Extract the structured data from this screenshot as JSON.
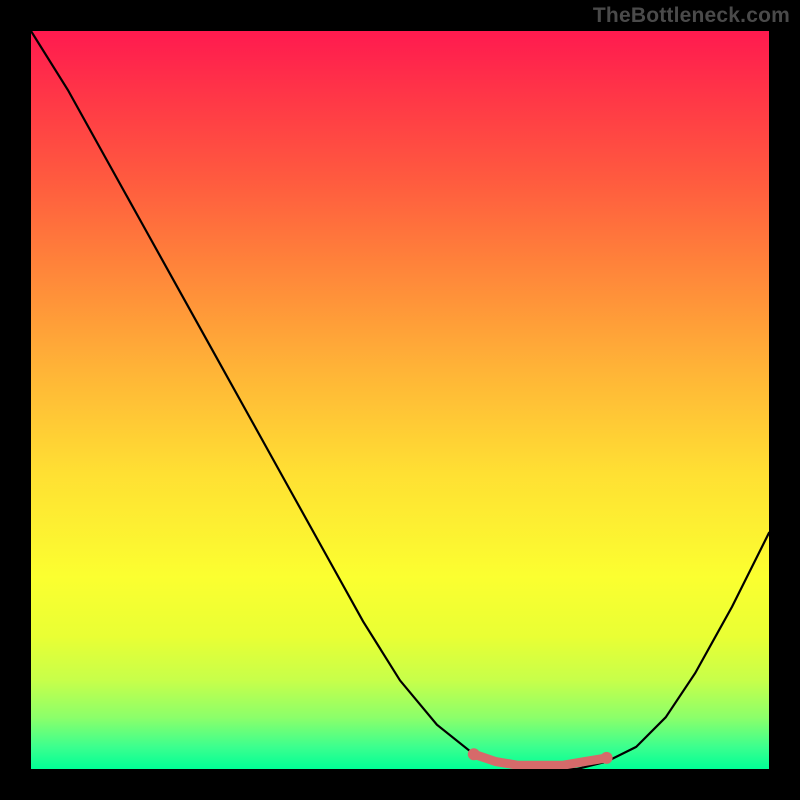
{
  "watermark": "TheBottleneck.com",
  "colors": {
    "frame_bg": "#000000",
    "curve_stroke": "#000000",
    "marker_stroke": "#d66a6a",
    "marker_fill": "#d66a6a"
  },
  "chart_data": {
    "type": "line",
    "title": "",
    "xlabel": "",
    "ylabel": "",
    "xlim": [
      0,
      100
    ],
    "ylim": [
      0,
      100
    ],
    "grid": false,
    "legend": false,
    "series": [
      {
        "name": "bottleneck_curve",
        "x": [
          0,
          5,
          10,
          15,
          20,
          25,
          30,
          35,
          40,
          45,
          50,
          55,
          60,
          63,
          67,
          70,
          74,
          78,
          82,
          86,
          90,
          95,
          100
        ],
        "y": [
          100,
          92,
          83,
          74,
          65,
          56,
          47,
          38,
          29,
          20,
          12,
          6,
          2,
          1,
          0,
          0,
          0,
          1,
          3,
          7,
          13,
          22,
          32
        ]
      }
    ],
    "markers": {
      "name": "optimal_range",
      "x": [
        60,
        63,
        66,
        69,
        72,
        75,
        78
      ],
      "y": [
        2,
        1,
        0.5,
        0.5,
        0.5,
        1,
        1.5
      ],
      "endpoint_left": {
        "x": 60,
        "y": 2
      },
      "endpoint_right": {
        "x": 78,
        "y": 1.5
      }
    },
    "annotations": []
  }
}
